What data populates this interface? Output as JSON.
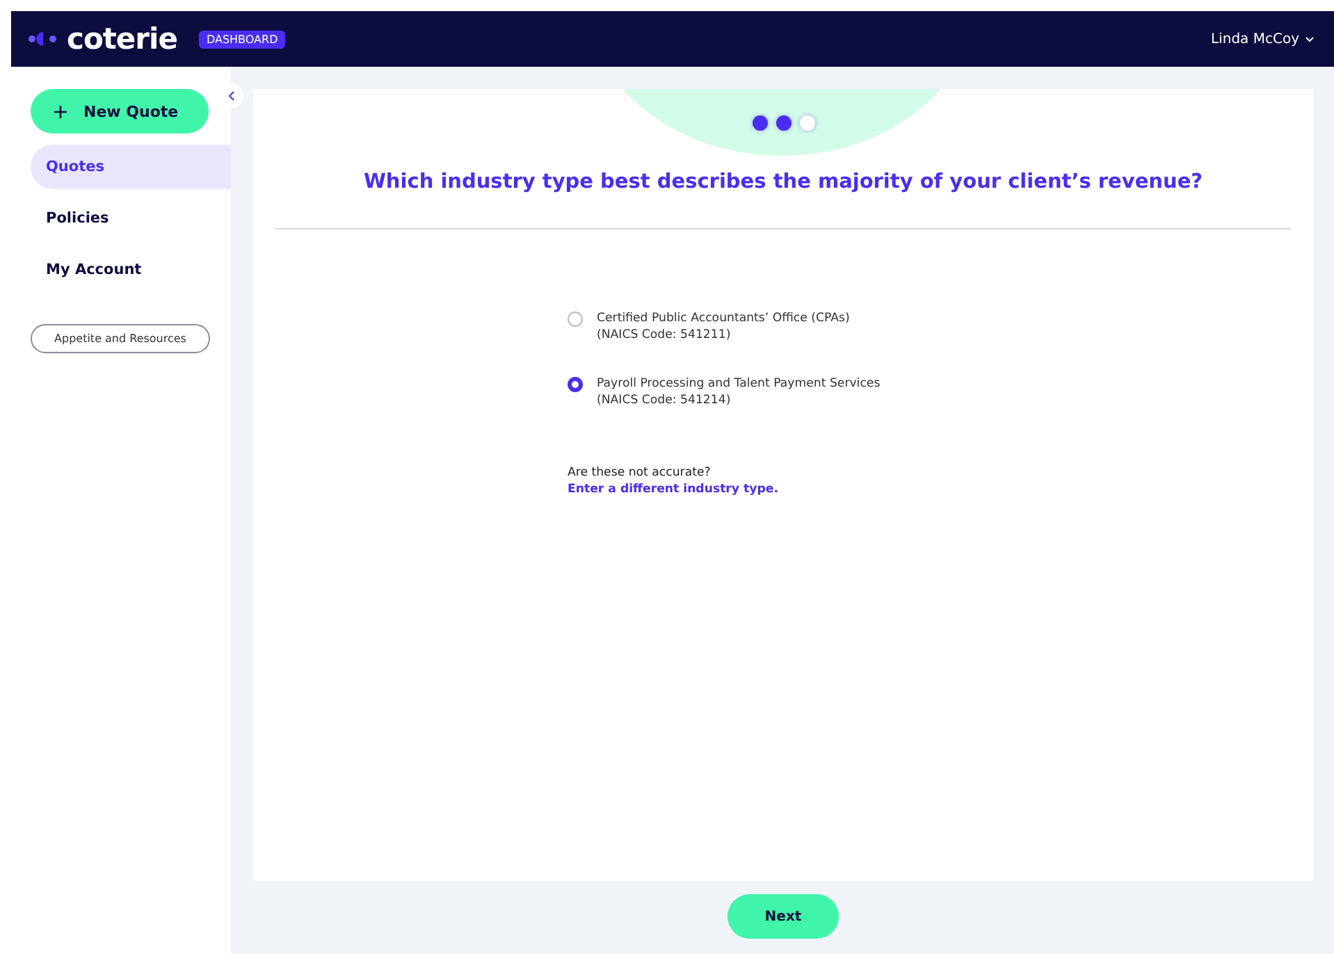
{
  "header": {
    "logo": "coterie",
    "badge": "DASHBOARD",
    "user": "Linda McCoy"
  },
  "sidebar": {
    "new_quote": "New Quote",
    "items": [
      {
        "label": "Quotes",
        "selected": true
      },
      {
        "label": "Policies",
        "selected": false
      },
      {
        "label": "My Account",
        "selected": false
      }
    ],
    "resources_button": "Appetite and Resources"
  },
  "progress": [
    {
      "done": true
    },
    {
      "done": true
    },
    {
      "done": false
    }
  ],
  "question": "Which industry type best describes the majority of your client’s revenue?",
  "options": [
    {
      "label": "Certified Public Accountants’ Office (CPAs)",
      "code": "(NAICS Code: 541211)",
      "selected": false
    },
    {
      "label": "Payroll Processing and Talent Payment Services",
      "code": "(NAICS Code: 541214)",
      "selected": true
    }
  ],
  "help": {
    "text": "Are these not accurate?",
    "link": "Enter a different industry type."
  },
  "next_button": "Next"
}
